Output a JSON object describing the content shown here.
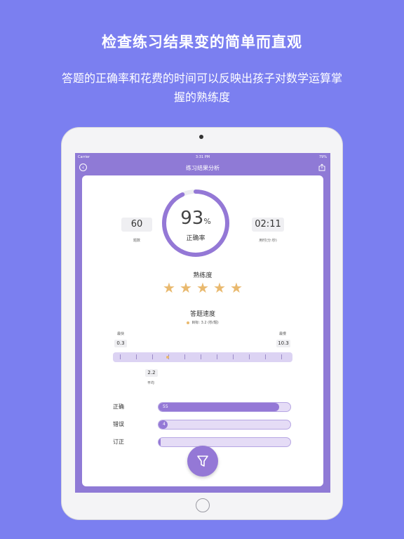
{
  "promo": {
    "headline": "检查练习结果变的简单而直观",
    "subline": "答题的正确率和花费的时间可以反映出孩子对数学运算掌握的熟练度"
  },
  "status_bar": {
    "carrier": "Carrier",
    "time": "3:31 PM",
    "battery": "79%"
  },
  "nav": {
    "title": "练习结果分析",
    "back_icon": "back-circle-icon",
    "share_icon": "share-icon"
  },
  "summary": {
    "count_value": "60",
    "count_label": "题数",
    "accuracy_value": "93",
    "accuracy_unit": "%",
    "accuracy_label": "正确率",
    "accuracy_fraction": 0.93,
    "time_value": "02:11",
    "time_label": "用时(分:秒)"
  },
  "proficiency": {
    "title": "熟练度",
    "stars": 5,
    "max_stars": 5
  },
  "speed": {
    "title": "答题速度",
    "goal_text": "目标: 3.2  (秒/题)",
    "fastest_label": "最快",
    "fastest_value": "0.3",
    "slowest_label": "最慢",
    "slowest_value": "10.3",
    "average_value": "2.2",
    "average_label": "平均"
  },
  "results": [
    {
      "label": "正确",
      "value": "55",
      "fraction": 0.917
    },
    {
      "label": "错误",
      "value": "4",
      "fraction": 0.067
    },
    {
      "label": "订正",
      "value": "",
      "fraction": 0.0
    }
  ],
  "colors": {
    "background": "#7b7ff0",
    "accent": "#9478d6",
    "star": "#e9b96e"
  },
  "fab_icon": "filter-icon"
}
